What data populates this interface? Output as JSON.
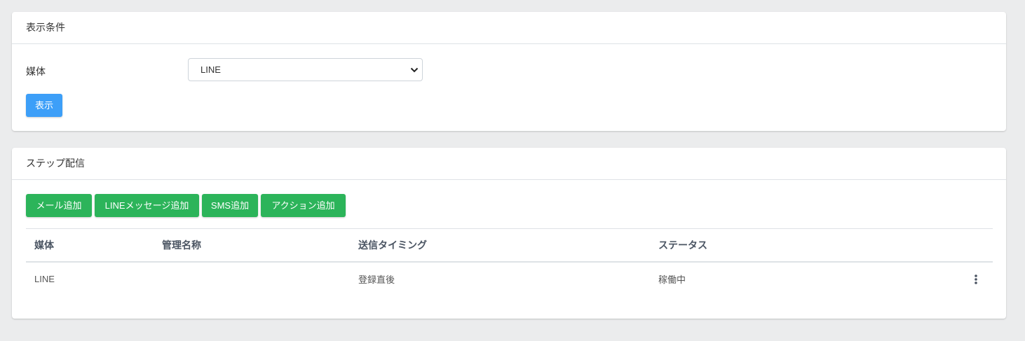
{
  "filter_card": {
    "title": "表示条件",
    "media_label": "媒体",
    "media_select_value": "LINE",
    "show_button": "表示"
  },
  "step_card": {
    "title": "ステップ配信",
    "buttons": {
      "add_mail": "メール追加",
      "add_line": "LINEメッセージ追加",
      "add_sms": "SMS追加",
      "add_action": "アクション追加"
    },
    "table": {
      "headers": {
        "media": "媒体",
        "name": "管理名称",
        "timing": "送信タイミング",
        "status": "ステータス"
      },
      "rows": [
        {
          "media": "LINE",
          "name": "",
          "timing": "登録直後",
          "status": "稼働中"
        }
      ]
    }
  },
  "colors": {
    "primary": "#3d9ff8",
    "success": "#2cb45a",
    "background": "#ebeced"
  },
  "icons": {
    "select_arrow": "chevron-down-icon",
    "row_menu": "kebab-menu-icon"
  }
}
